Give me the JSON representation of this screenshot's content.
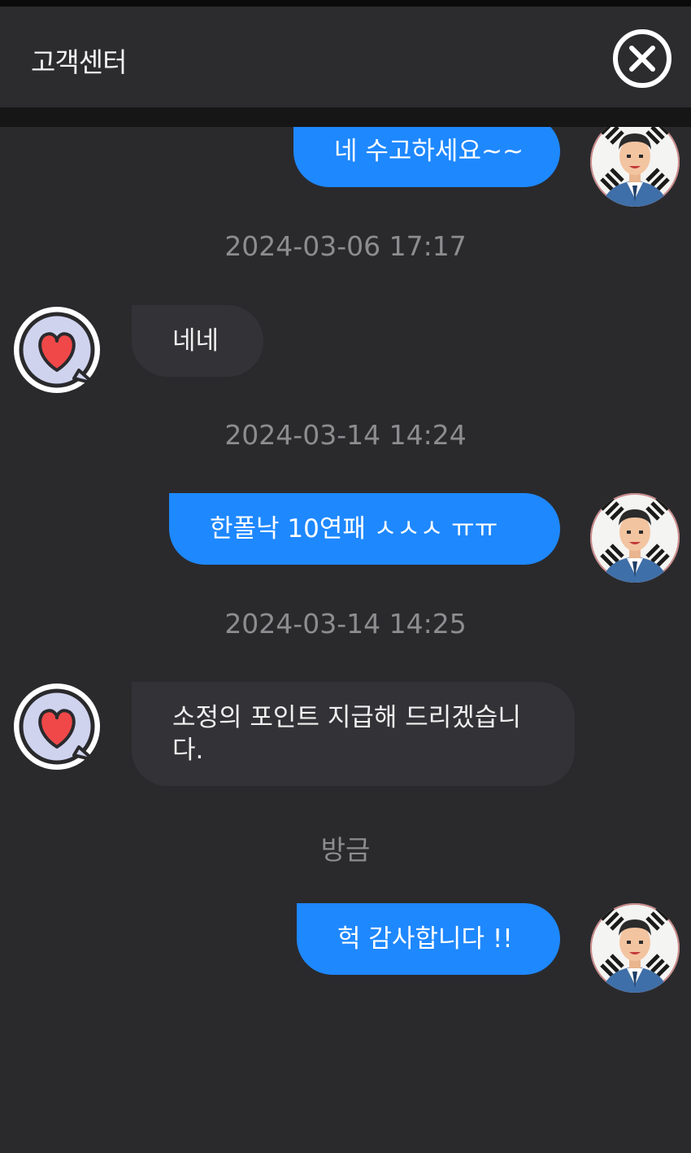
{
  "header": {
    "title": "고객센터",
    "close_icon": "close-circle-icon"
  },
  "messages": [
    {
      "sender": "user",
      "text": "네 수고하세요~~",
      "avatar": "korean-flag-man-avatar"
    },
    {
      "type": "timestamp",
      "text": "2024-03-06 17:17"
    },
    {
      "sender": "agent",
      "text": "네네",
      "avatar": "heart-speech-bubble-avatar"
    },
    {
      "type": "timestamp",
      "text": "2024-03-14 14:24"
    },
    {
      "sender": "user",
      "text": "한폴낙 10연패 ㅅㅅㅅ ㅠㅠ",
      "avatar": "korean-flag-man-avatar"
    },
    {
      "type": "timestamp",
      "text": "2024-03-14 14:25"
    },
    {
      "sender": "agent",
      "text": "소정의 포인트 지급해 드리겠습니다.",
      "avatar": "heart-speech-bubble-avatar"
    },
    {
      "type": "timestamp",
      "text": "방금"
    },
    {
      "sender": "user",
      "text": "헉 감사합니다 !!",
      "avatar": "korean-flag-man-avatar"
    }
  ],
  "colors": {
    "background": "#2a2a2d",
    "header": "#2c2c2f",
    "outgoing_bubble": "#1e88ff",
    "incoming_bubble": "#333337",
    "timestamp_text": "#8d8d90"
  }
}
